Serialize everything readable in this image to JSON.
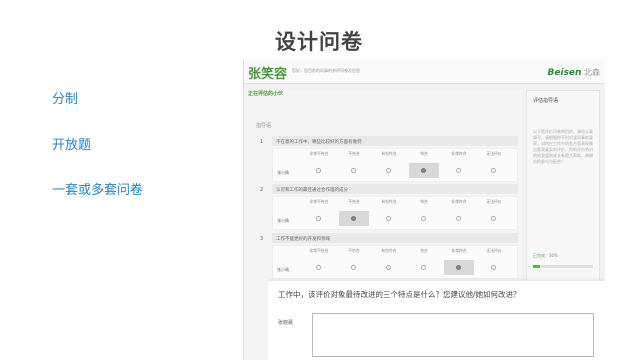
{
  "slide": {
    "title": "设计问卷",
    "menu": [
      "分制",
      "开放题",
      "一套或多套问卷"
    ]
  },
  "survey": {
    "header": {
      "name": "张笑容",
      "subtitle": "您好，您目前的同事的参评问卷及信息",
      "logo_brand": "Beisen",
      "logo_suffix": "北森"
    },
    "section_label": "正在评估的小伙",
    "intro": "指导语",
    "scale_labels": [
      "非常不符合",
      "不符合",
      "有些符合",
      "符合",
      "非常符合",
      "无法评价"
    ],
    "row_label": "张小倩",
    "questions": [
      {
        "num": "1",
        "text": "不在意的工作中，哪些比较好的方面有做到",
        "selected": 3
      },
      {
        "num": "2",
        "text": "认可和工作的最佳通过合作理的成分",
        "selected": 1
      },
      {
        "num": "3",
        "text": "工作不能更好的开发和领域",
        "selected": 4
      }
    ],
    "side_panel": {
      "title": "评估指导语",
      "body": "以下是评价问卷的目的，请你认真填写。请根据你平时对该同事的观察，对他在工作中的各方面表现做出客观真实的评价，你的评价将对他的发展和成长有很大帮助，谢谢你的参与与配合！",
      "progress_label": "已完成：30%",
      "progress": 0.12
    },
    "open_question": {
      "title": "工作中，该评价对象最待改进的三个特点是什么？您建议他/她如何改进？",
      "row_label": "张晓晨",
      "answer": ""
    }
  },
  "colors": {
    "accent_green": "#4a9a3c",
    "link_blue": "#2b84c4"
  }
}
